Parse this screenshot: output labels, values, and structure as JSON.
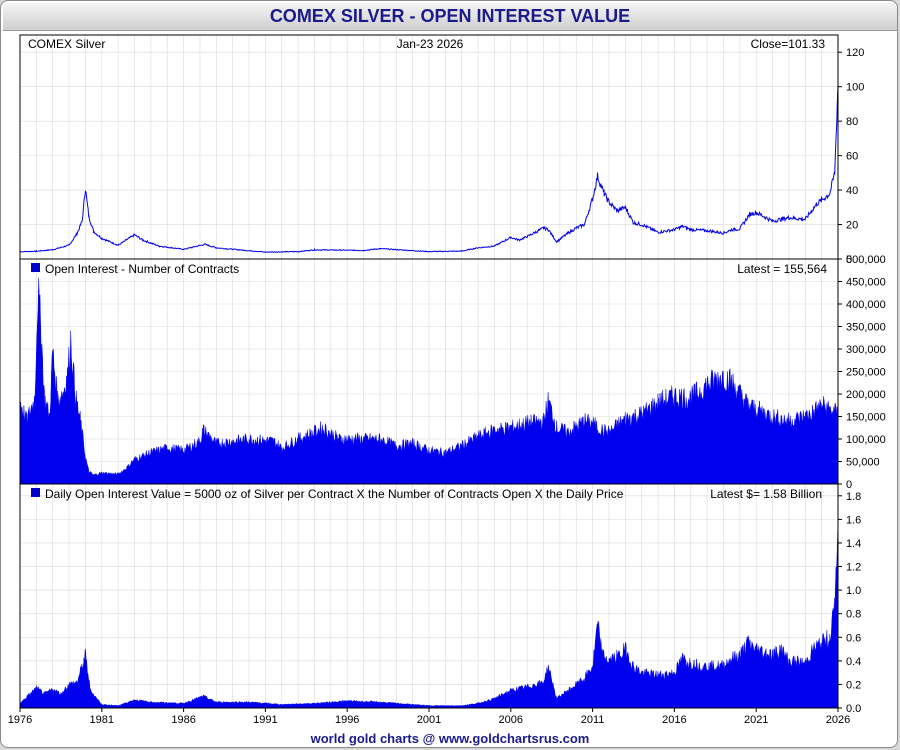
{
  "header": {
    "title": "COMEX SILVER - OPEN INTEREST VALUE"
  },
  "footer": {
    "credit": "world gold charts @ www.goldchartsrus.com"
  },
  "panels": {
    "price": {
      "left_label": "COMEX Silver",
      "date_label": "Jan-23  2026",
      "right_label": "Close=101.33"
    },
    "oi": {
      "left_label": "Open Interest - Number of Contracts",
      "right_label": "Latest = 155,564"
    },
    "value": {
      "left_label": "Daily Open Interest Value = 5000 oz of Silver per Contract X the Number of Contracts Open X the Daily Price",
      "right_label": "Latest $= 1.58 Billion"
    }
  },
  "colors": {
    "series": "#0000ee",
    "grid": "#d9d9d9",
    "frame": "#000000",
    "title": "#1a1a8c",
    "legend_square": "#0000cc"
  },
  "chart_data": [
    {
      "type": "line",
      "series_label": "COMEX Silver",
      "ylim": [
        0,
        130
      ],
      "yticks": [
        0,
        20,
        40,
        60,
        80,
        100,
        120
      ],
      "ytick_labels": [
        "0",
        "20",
        "40",
        "60",
        "80",
        "100",
        "120"
      ],
      "xlim": [
        1976,
        2026
      ],
      "grid": true,
      "x": [
        1976.0,
        1977.0,
        1978.0,
        1979.0,
        1979.5,
        1979.8,
        1980.0,
        1980.2,
        1980.5,
        1981.0,
        1982.0,
        1983.0,
        1983.5,
        1984.5,
        1986.0,
        1987.3,
        1988.0,
        1991.0,
        1993.0,
        1994.0,
        1997.0,
        1998.0,
        2001.0,
        2003.0,
        2004.0,
        2005.0,
        2006.0,
        2006.5,
        2007.0,
        2008.0,
        2008.3,
        2008.8,
        2009.5,
        2010.0,
        2010.5,
        2011.0,
        2011.3,
        2011.7,
        2012.0,
        2012.5,
        2013.0,
        2013.5,
        2014.0,
        2015.0,
        2016.0,
        2016.5,
        2017.0,
        2018.0,
        2019.0,
        2019.5,
        2020.0,
        2020.6,
        2021.0,
        2022.0,
        2023.0,
        2024.0,
        2024.7,
        2025.0,
        2025.5,
        2025.8,
        2026.0
      ],
      "values": [
        4.2,
        4.5,
        5.4,
        8.0,
        15.0,
        22.0,
        41.0,
        25.0,
        16.0,
        12.0,
        8.0,
        14.0,
        11.0,
        7.5,
        5.6,
        8.5,
        6.5,
        4.0,
        4.3,
        5.3,
        5.0,
        6.0,
        4.3,
        4.6,
        6.5,
        7.5,
        12.5,
        11.0,
        13.0,
        18.0,
        17.0,
        10.0,
        15.0,
        18.0,
        20.0,
        35.0,
        48.0,
        38.0,
        33.0,
        28.0,
        30.0,
        21.0,
        20.0,
        15.5,
        17.0,
        19.0,
        17.0,
        16.5,
        15.0,
        17.0,
        17.5,
        26.0,
        27.0,
        22.0,
        24.0,
        23.0,
        32.0,
        34.0,
        38.0,
        50.0,
        101.33
      ]
    },
    {
      "type": "area",
      "series_label": "Open Interest - Number of Contracts",
      "ylim": [
        0,
        500000
      ],
      "yticks": [
        0,
        50000,
        100000,
        150000,
        200000,
        250000,
        300000,
        350000,
        400000,
        450000,
        500000
      ],
      "ytick_labels": [
        "0",
        "50,000",
        "100,000",
        "150,000",
        "200,000",
        "250,000",
        "300,000",
        "350,000",
        "400,000",
        "450,000",
        "500,000"
      ],
      "xlim": [
        1976,
        2026
      ],
      "grid": true,
      "x": [
        1976.0,
        1976.4,
        1976.9,
        1977.1,
        1977.3,
        1977.5,
        1977.8,
        1978.0,
        1978.3,
        1978.6,
        1978.9,
        1979.1,
        1979.4,
        1979.7,
        1980.0,
        1980.2,
        1980.5,
        1981.0,
        1982.0,
        1982.5,
        1983.0,
        1984.0,
        1985.0,
        1986.0,
        1987.0,
        1987.2,
        1988.0,
        1990.0,
        1991.5,
        1992.0,
        1993.0,
        1994.0,
        1994.5,
        1995.5,
        1997.0,
        1998.0,
        1999.0,
        2000.0,
        2001.0,
        2002.0,
        2003.0,
        2004.0,
        2005.0,
        2006.0,
        2007.0,
        2008.0,
        2008.3,
        2008.8,
        2009.5,
        2010.5,
        2011.0,
        2011.5,
        2012.0,
        2013.0,
        2014.0,
        2015.0,
        2016.0,
        2017.0,
        2018.0,
        2018.5,
        2019.0,
        2019.5,
        2020.0,
        2020.5,
        2021.0,
        2022.0,
        2023.0,
        2024.0,
        2024.5,
        2025.0,
        2025.5,
        2026.0
      ],
      "values": [
        185000,
        140000,
        190000,
        430000,
        330000,
        190000,
        150000,
        290000,
        190000,
        200000,
        240000,
        320000,
        190000,
        140000,
        60000,
        28000,
        20000,
        25000,
        22000,
        35000,
        55000,
        70000,
        80000,
        75000,
        95000,
        120000,
        90000,
        100000,
        95000,
        80000,
        100000,
        115000,
        125000,
        100000,
        100000,
        100000,
        85000,
        90000,
        75000,
        70000,
        85000,
        105000,
        120000,
        125000,
        135000,
        140000,
        185000,
        125000,
        115000,
        140000,
        135000,
        120000,
        115000,
        145000,
        155000,
        180000,
        195000,
        190000,
        220000,
        230000,
        240000,
        225000,
        200000,
        175000,
        165000,
        150000,
        140000,
        150000,
        160000,
        175000,
        165000,
        155564
      ]
    },
    {
      "type": "area",
      "series_label": "Daily Open Interest Value = 5000 oz of Silver per Contract X the Number of Contracts Open X the Daily Price",
      "unit": "Billion $",
      "ylim": [
        0,
        1.9
      ],
      "yticks": [
        0.0,
        0.2,
        0.4,
        0.6,
        0.8,
        1.0,
        1.2,
        1.4,
        1.6,
        1.8
      ],
      "ytick_labels": [
        "0.0",
        "0.2",
        "0.4",
        "0.6",
        "0.8",
        "1.0",
        "1.2",
        "1.4",
        "1.6",
        "1.8"
      ],
      "xlim": [
        1976,
        2026
      ],
      "xticks": [
        1976,
        1981,
        1986,
        1991,
        1996,
        2001,
        2006,
        2011,
        2016,
        2021,
        2026
      ],
      "xtick_labels": [
        "1976",
        "1981",
        "1986",
        "1991",
        "1996",
        "2001",
        "2006",
        "2011",
        "2016",
        "2021",
        "2026"
      ],
      "grid": true,
      "x": [
        1976.0,
        1977.0,
        1977.5,
        1978.0,
        1978.5,
        1979.0,
        1979.5,
        1979.9,
        1980.0,
        1980.3,
        1981.0,
        1982.0,
        1983.0,
        1984.0,
        1986.0,
        1987.2,
        1988.0,
        1990.0,
        1992.0,
        1994.0,
        1996.0,
        1998.0,
        2000.0,
        2001.0,
        2003.0,
        2004.0,
        2005.0,
        2006.0,
        2007.0,
        2008.0,
        2008.3,
        2008.8,
        2009.5,
        2010.5,
        2011.0,
        2011.3,
        2011.6,
        2012.0,
        2012.7,
        2013.0,
        2013.5,
        2014.0,
        2015.0,
        2016.0,
        2016.5,
        2017.0,
        2018.0,
        2019.0,
        2019.5,
        2020.0,
        2020.5,
        2021.0,
        2022.0,
        2022.5,
        2023.0,
        2024.0,
        2024.5,
        2025.0,
        2025.5,
        2025.8,
        2026.0
      ],
      "values": [
        0.04,
        0.17,
        0.12,
        0.16,
        0.12,
        0.2,
        0.22,
        0.4,
        0.45,
        0.15,
        0.03,
        0.02,
        0.07,
        0.05,
        0.04,
        0.1,
        0.05,
        0.05,
        0.03,
        0.04,
        0.06,
        0.05,
        0.03,
        0.02,
        0.02,
        0.04,
        0.08,
        0.15,
        0.18,
        0.22,
        0.35,
        0.08,
        0.15,
        0.25,
        0.35,
        0.7,
        0.45,
        0.4,
        0.45,
        0.5,
        0.35,
        0.3,
        0.28,
        0.3,
        0.42,
        0.38,
        0.35,
        0.36,
        0.42,
        0.45,
        0.55,
        0.5,
        0.45,
        0.5,
        0.4,
        0.38,
        0.5,
        0.55,
        0.6,
        0.85,
        1.58
      ]
    }
  ]
}
